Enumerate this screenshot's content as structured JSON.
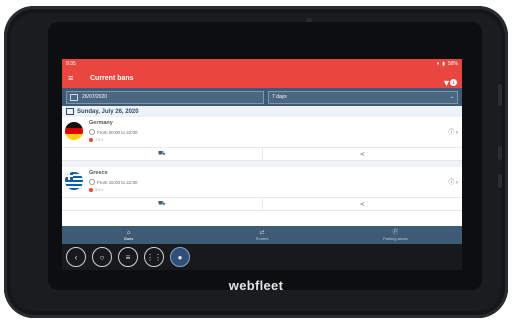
{
  "status_bar": {
    "time": "9:35",
    "battery": "58%"
  },
  "app_bar": {
    "title": "Current bans",
    "menu_icon": "hamburger-icon",
    "filter_icon": "filter-icon",
    "filter_badge": "1"
  },
  "filters": {
    "date": "26/07/2020",
    "period": "7 days"
  },
  "day_header": "Sunday, July 26, 2020",
  "bans": [
    {
      "country": "Germany",
      "time": "From 00:00 to 22:00",
      "weight": "7.5 t",
      "flag": "germany-flag"
    },
    {
      "country": "Greece",
      "time": "From 15:00 to 22:00",
      "weight": "3.5 t",
      "flag": "greece-flag"
    }
  ],
  "bottom_nav": [
    {
      "label": "Bans",
      "icon": "home-icon",
      "active": true
    },
    {
      "label": "Routes",
      "icon": "route-icon",
      "active": false
    },
    {
      "label": "Parking areas",
      "icon": "parking-icon",
      "active": false
    }
  ],
  "system_buttons": [
    "back-button",
    "home-button",
    "menu-button",
    "apps-button",
    "browser-button"
  ],
  "brand": "webfleet",
  "colors": {
    "accent": "#e8463e",
    "navy": "#3e5b76"
  }
}
